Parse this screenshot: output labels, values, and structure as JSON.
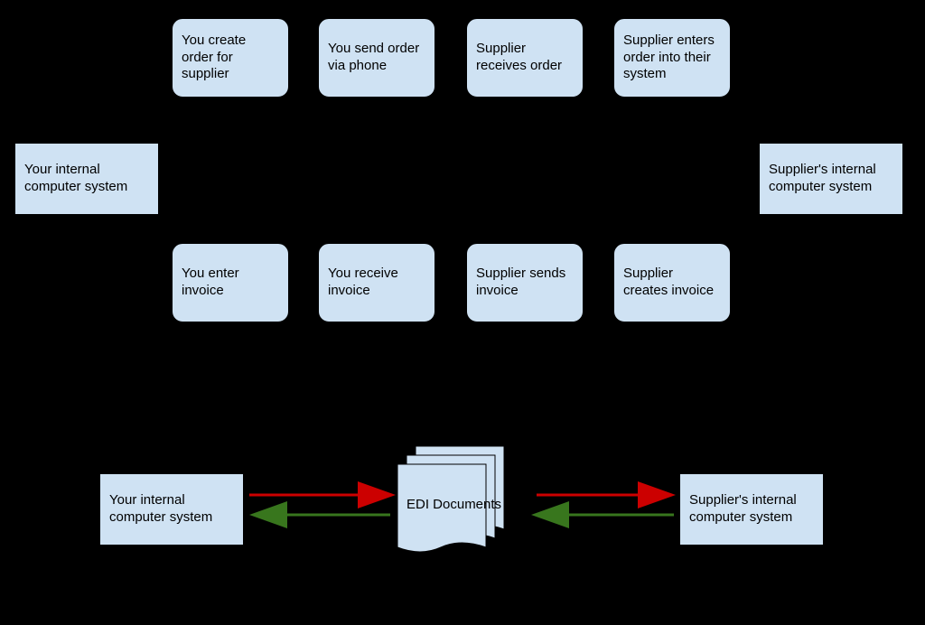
{
  "colors": {
    "boxFill": "#cfe2f3",
    "boxStroke": "#000000",
    "arrowBlack": "#000000",
    "arrowRed": "#cc0000",
    "arrowGreen": "#38761d"
  },
  "top": {
    "left": {
      "yourSystem": "Your internal computer system",
      "supplierSystem": "Supplier's internal computer system"
    },
    "steps": {
      "s1": "You create order for supplier",
      "s2": "You send order via phone",
      "s3": "Supplier receives order",
      "s4": "Supplier enters order into their system",
      "s5": "Supplier creates invoice",
      "s6": "Supplier sends invoice",
      "s7": "You receive invoice",
      "s8": "You enter invoice"
    }
  },
  "bottom": {
    "yourSystem": "Your internal computer system",
    "ediDocs": "EDI Documents",
    "supplierSystem": "Supplier's internal computer system"
  },
  "flows": {
    "topRow": [
      {
        "from": "yourSystem",
        "to": "s1",
        "color": "black"
      },
      {
        "from": "s1",
        "to": "s2",
        "color": "black"
      },
      {
        "from": "s2",
        "to": "s3",
        "color": "black"
      },
      {
        "from": "s3",
        "to": "s4",
        "color": "black"
      },
      {
        "from": "s4",
        "to": "supplierSystem",
        "color": "black"
      }
    ],
    "bottomRow": [
      {
        "from": "supplierSystem",
        "to": "s5",
        "color": "black"
      },
      {
        "from": "s5",
        "to": "s6",
        "color": "black"
      },
      {
        "from": "s6",
        "to": "s7",
        "color": "black"
      },
      {
        "from": "s7",
        "to": "s8",
        "color": "black"
      },
      {
        "from": "s8",
        "to": "yourSystem",
        "color": "black"
      }
    ],
    "edi": [
      {
        "from": "yourSystem",
        "to": "ediDocs",
        "direction": "right",
        "color": "red"
      },
      {
        "from": "ediDocs",
        "to": "supplierSystem",
        "direction": "right",
        "color": "red"
      },
      {
        "from": "supplierSystem",
        "to": "ediDocs",
        "direction": "left",
        "color": "green"
      },
      {
        "from": "ediDocs",
        "to": "yourSystem",
        "direction": "left",
        "color": "green"
      }
    ]
  }
}
